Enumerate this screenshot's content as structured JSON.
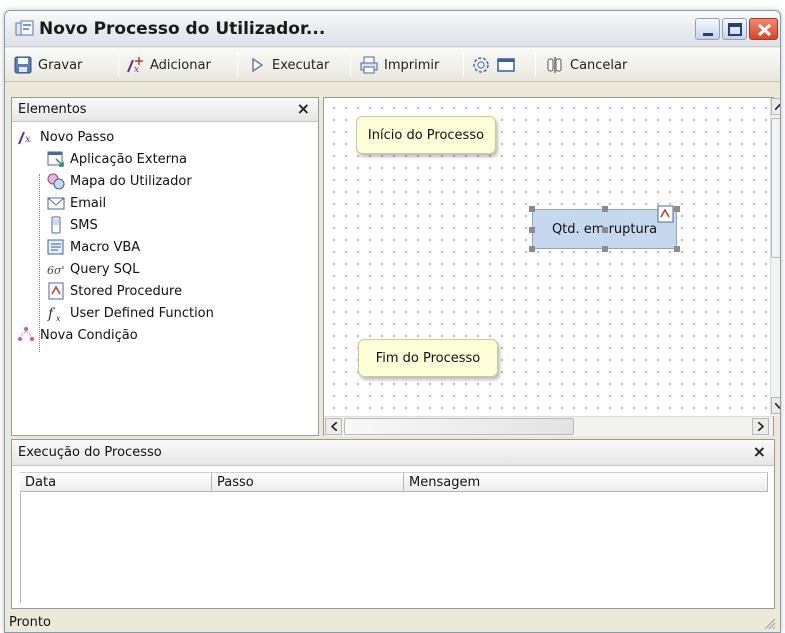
{
  "window": {
    "title": "Novo Processo do Utilizador..."
  },
  "toolbar": {
    "save_label": "Gravar",
    "add_label": "Adicionar",
    "run_label": "Executar",
    "print_label": "Imprimir",
    "cancel_label": "Cancelar"
  },
  "elements_panel": {
    "title": "Elementos",
    "close_glyph": "×",
    "items": [
      {
        "label": "Novo Passo",
        "icon": "new-step-icon",
        "level": 0
      },
      {
        "label": "Aplicação Externa",
        "icon": "external-app-icon",
        "level": 1
      },
      {
        "label": "Mapa do Utilizador",
        "icon": "user-map-icon",
        "level": 1
      },
      {
        "label": "Email",
        "icon": "email-icon",
        "level": 1
      },
      {
        "label": "SMS",
        "icon": "sms-icon",
        "level": 1
      },
      {
        "label": "Macro VBA",
        "icon": "vba-macro-icon",
        "level": 1
      },
      {
        "label": "Query SQL",
        "icon": "sql-query-icon",
        "level": 1
      },
      {
        "label": "Stored Procedure",
        "icon": "stored-procedure-icon",
        "level": 1
      },
      {
        "label": "User Defined Function",
        "icon": "function-icon",
        "level": 1
      },
      {
        "label": "Nova Condição",
        "icon": "new-condition-icon",
        "level": 0
      }
    ]
  },
  "canvas": {
    "start_node": "Início do Processo",
    "step_node": "Qtd. em ruptura",
    "end_node": "Fim do Processo"
  },
  "exec_panel": {
    "title": "Execução do Processo",
    "close_glyph": "×",
    "columns": [
      "Data",
      "Passo",
      "Mensagem"
    ],
    "rows": []
  },
  "status": {
    "text": "Pronto"
  },
  "colors": {
    "window_bg": "#ece9d8",
    "terminal_node": "#fdfdd7",
    "step_node": "#c6d8ee",
    "close_button": "#d4452a"
  }
}
